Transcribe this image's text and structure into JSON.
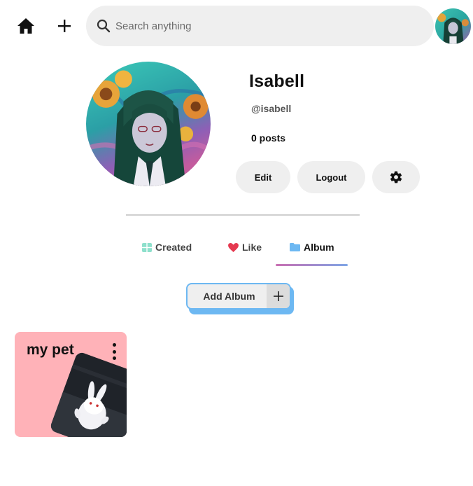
{
  "topbar": {
    "search_placeholder": "Search anything"
  },
  "profile": {
    "name": "Isabell",
    "handle": "@isabell",
    "posts_count": "0",
    "posts_label": " posts"
  },
  "actions": {
    "edit_label": "Edit",
    "logout_label": "Logout"
  },
  "tabs": [
    {
      "label": "Created",
      "icon": "grid-icon",
      "active": false
    },
    {
      "label": "Like",
      "icon": "heart-icon",
      "active": false
    },
    {
      "label": "Album",
      "icon": "folder-icon",
      "active": true
    }
  ],
  "add_album": {
    "label": "Add Album"
  },
  "albums": [
    {
      "title": "my pet"
    }
  ],
  "colors": {
    "search_bg": "#efefef",
    "pill_bg": "#efefef",
    "accent_blue": "#6db8f2",
    "heart_red": "#e53950",
    "grid_teal": "#8ee0cc",
    "album_card_bg": "#ffb2b8",
    "tab_underline_start": "#c96fb2",
    "tab_underline_end": "#7fa6e6"
  }
}
